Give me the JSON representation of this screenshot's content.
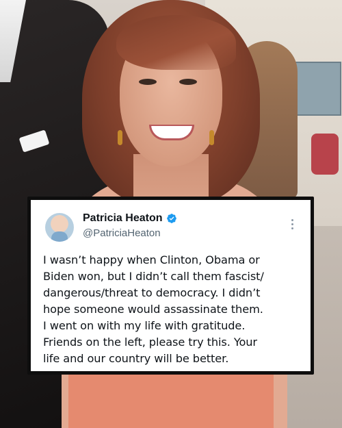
{
  "tweet": {
    "author_name": "Patricia Heaton",
    "handle": "@PatriciaHeaton",
    "verified": true,
    "accent_color": "#1d9bf0",
    "lines": [
      "I wasn’t happy when Clinton, Obama or",
      "Biden won, but I didn’t call them fascist/",
      "dangerous/threat to democracy. I didn’t",
      "hope someone would assassinate them.",
      "I went on with my life with gratitude.",
      "Friends on the left, please try this. Your",
      "life and our country will be better."
    ]
  },
  "icons": {
    "verified": "verified-badge-icon",
    "more": "more-options-icon"
  }
}
